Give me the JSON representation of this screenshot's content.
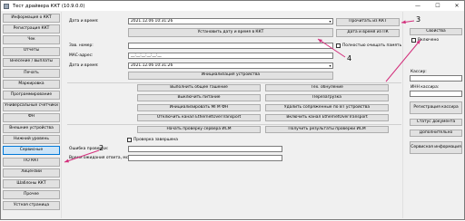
{
  "window": {
    "title": "Тест драйвера ККТ (10.9.0.0)",
    "minimize_glyph": "—",
    "maximize_glyph": "☐",
    "close_glyph": "✕"
  },
  "nav": {
    "items": [
      "Информация о ККТ",
      "Регистрация ККТ",
      "Чек",
      "Отчеты",
      "Внесение / выплаты",
      "Печать",
      "Маркировка",
      "Программирование",
      "Универсальные счетчики",
      "ФН",
      "Внешние устройства",
      "Нижний уровень",
      "Сервисные",
      "ПО ККТ",
      "Лицензии",
      "Шаблоны ККТ",
      "Прочее",
      "Устная страница"
    ],
    "selected": "Сервисные"
  },
  "main": {
    "datetime_label": "Дата и время:",
    "datetime_value": "2021.12.06 10:31:26",
    "set_pc_time_btn": "Установить дату и время в ККТ",
    "read_kkt_btn": "Прочитать из ККТ",
    "pc_datetime_btn": "Дата и время из ПК",
    "serial_label": "Зав. номер:",
    "serial_value": "",
    "mac_label": "MAC-адрес:",
    "mac_value": "__:__:__:__:__:__",
    "date_label": "Дата и время:",
    "date_value": "2021.12.06 10:31:26",
    "full_clear_label": "Полностью очищать память",
    "init_btn": "Инициализация устройства",
    "general_clear_btn": "Выполнить общее гашение",
    "tech_zero_btn": "Тех. обнуление",
    "power_off_btn": "Выключить питание",
    "reboot_btn": "Перезагрузка",
    "init_mgm_btn": "Инициализировать МГМ ФН",
    "bt_remove_btn": "Удалить сопряженные по BT устройства",
    "disable_eot_btn": "Отключить канал EthernetOverTransport",
    "enable_eot_btn": "Включить канал EthernetOverTransport",
    "start_ism_btn": "Начать проверку сервера ИСМ",
    "ism_result_btn": "Получить результаты проверки ИСМ",
    "check_done_label": "Проверка завершена",
    "check_error_label": "Ошибка проверки:",
    "check_error_value": "",
    "wait_time_label": "Время ожидания ответа, мс:",
    "wait_time_value": ""
  },
  "right": {
    "properties_btn": "Свойства",
    "enabled_label": "Включено",
    "cashier_label": "Кассир:",
    "cashier_value": "",
    "inn_label": "ИНН кассира:",
    "inn_value": "",
    "reg_cashier_btn": "Регистрация кассира",
    "doc_status_btn": "Статус документа",
    "additional_btn": "Дополнительно",
    "service_info_btn": "Сервисная информация"
  },
  "annotations": {
    "n2": "2",
    "n3": "3",
    "n4": "4",
    "arrow_color": "#d32f7c"
  },
  "icons": {
    "dropdown": "▾"
  }
}
